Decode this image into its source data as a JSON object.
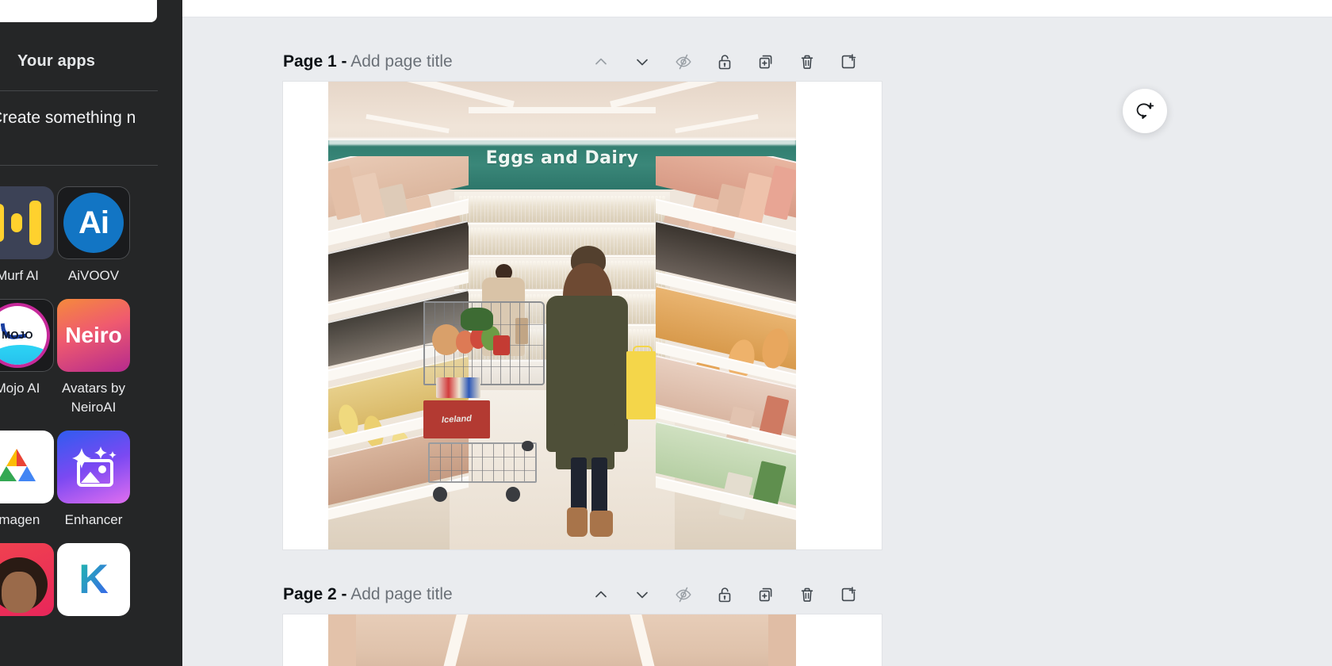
{
  "sidebar": {
    "heading": "Your apps",
    "create_label": "Create something n",
    "apps": [
      {
        "name": "Murf AI",
        "icon": "murf-ai-icon"
      },
      {
        "name": "AiVOOV",
        "icon": "aivoov-icon",
        "glyph": "Ai"
      },
      {
        "name": "Mojo AI",
        "icon": "mojo-ai-icon",
        "glyph": "MOJO"
      },
      {
        "name": "Avatars by NeiroAI",
        "icon": "neiro-icon",
        "glyph": "Neiro"
      },
      {
        "name": "Imagen",
        "icon": "google-imagen-icon"
      },
      {
        "name": "Enhancer",
        "icon": "enhancer-icon"
      },
      {
        "name": "",
        "icon": "avatar-app-icon"
      },
      {
        "name": "",
        "icon": "krea-k-icon"
      }
    ],
    "collapse_icon": "chevron-left-icon"
  },
  "canvas": {
    "background_color": "#eaecef",
    "comment_button": {
      "icon": "add-comment-icon",
      "label": ""
    },
    "pages": [
      {
        "number_label": "Page 1 -",
        "title_placeholder": "Add page title",
        "tools": [
          {
            "name": "move-page-up-button",
            "icon": "chevron-up-icon"
          },
          {
            "name": "move-page-down-button",
            "icon": "chevron-down-icon"
          },
          {
            "name": "hide-page-button",
            "icon": "eye-off-icon"
          },
          {
            "name": "lock-page-button",
            "icon": "unlock-icon"
          },
          {
            "name": "duplicate-page-button",
            "icon": "duplicate-icon"
          },
          {
            "name": "delete-page-button",
            "icon": "trash-icon"
          },
          {
            "name": "add-page-button",
            "icon": "add-page-icon"
          }
        ],
        "photo": {
          "alt": "supermarket-aisle-photo",
          "sign_text": "Eggs and Dairy",
          "sign_color": "#35806f",
          "cart_label": "Iceland"
        }
      },
      {
        "number_label": "Page 2 -",
        "title_placeholder": "Add page title",
        "tools": [
          {
            "name": "move-page-up-button",
            "icon": "chevron-up-icon"
          },
          {
            "name": "move-page-down-button",
            "icon": "chevron-down-icon"
          },
          {
            "name": "hide-page-button",
            "icon": "eye-off-icon"
          },
          {
            "name": "lock-page-button",
            "icon": "unlock-icon"
          },
          {
            "name": "duplicate-page-button",
            "icon": "duplicate-icon"
          },
          {
            "name": "delete-page-button",
            "icon": "trash-icon"
          },
          {
            "name": "add-page-button",
            "icon": "add-page-icon"
          }
        ]
      }
    ]
  }
}
